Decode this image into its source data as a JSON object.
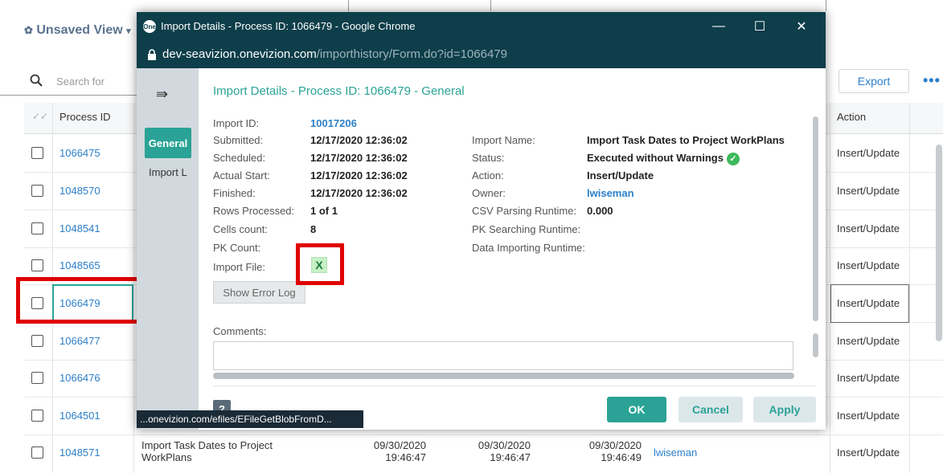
{
  "grid": {
    "view_title": "Unsaved View",
    "search_placeholder": "Search for",
    "export_label": "Export",
    "more_label": "•••",
    "col_process_id": "Process ID",
    "col_action": "Action",
    "rows": [
      {
        "pid": "1066475",
        "action": "Insert/Update"
      },
      {
        "pid": "1048570",
        "action": "Insert/Update"
      },
      {
        "pid": "1048541",
        "action": "Insert/Update"
      },
      {
        "pid": "1048565",
        "action": "Insert/Update"
      },
      {
        "pid": "1066479",
        "action": "Insert/Update"
      },
      {
        "pid": "1066477",
        "action": "Insert/Update"
      },
      {
        "pid": "1066476",
        "action": "Insert/Update"
      },
      {
        "pid": "1064501",
        "action": "Insert/Update"
      },
      {
        "pid": "1048571",
        "action": "Insert/Update",
        "name_line1": "Import Task Dates to Project",
        "name_line2": "WorkPlans",
        "date1": "09/30/2020",
        "time1": "19:46:47",
        "date2": "09/30/2020",
        "time2": "19:46:47",
        "date3": "09/30/2020",
        "time3": "19:46:49",
        "owner": "lwiseman"
      }
    ]
  },
  "window": {
    "title": "Import Details - Process ID: 1066479 - Google Chrome",
    "logo_text": "One",
    "url_host": "dev-seavizion.onevizion.com",
    "url_path": "/importhistory/Form.do?id=1066479",
    "min_glyph": "—",
    "max_glyph": "☐",
    "close_glyph": "✕",
    "status_url": "...onevizion.com/efiles/EFileGetBlobFromD..."
  },
  "sidebar": {
    "collapse_glyph": "⇛",
    "tab_general": "General",
    "tab_import": "Import L"
  },
  "details": {
    "heading": "Import Details - Process ID: 1066479 - General",
    "left": [
      {
        "label": "Import ID:",
        "value": "10017206",
        "link": true
      },
      {
        "label": "Submitted:",
        "value": "12/17/2020 12:36:02"
      },
      {
        "label": "Scheduled:",
        "value": "12/17/2020 12:36:02"
      },
      {
        "label": "Actual Start:",
        "value": "12/17/2020 12:36:02"
      },
      {
        "label": "Finished:",
        "value": "12/17/2020 12:36:02"
      },
      {
        "label": "Rows Processed:",
        "value": "1 of 1"
      },
      {
        "label": "Cells count:",
        "value": "8"
      },
      {
        "label": "PK Count:",
        "value": ""
      },
      {
        "label": "Import File:",
        "value": ""
      }
    ],
    "right": [
      {
        "label": "Import Name:",
        "value": "Import Task Dates to Project WorkPlans"
      },
      {
        "label": "Status:",
        "value": "Executed without Warnings"
      },
      {
        "label": "Action:",
        "value": "Insert/Update"
      },
      {
        "label": "Owner:",
        "value": "lwiseman",
        "link": true
      },
      {
        "label": "CSV Parsing Runtime:",
        "value": "0.000"
      },
      {
        "label": "PK Searching Runtime:",
        "value": ""
      },
      {
        "label": "Data Importing Runtime:",
        "value": ""
      }
    ],
    "file_icon_glyph": "X",
    "show_error_log": "Show Error Log",
    "comments_label": "Comments:"
  },
  "footer": {
    "help": "?",
    "ok": "OK",
    "cancel": "Cancel",
    "apply": "Apply"
  },
  "colors": {
    "accent": "#2aa396",
    "link": "#2b7fc9",
    "titlebar": "#0d3e4a",
    "highlight": "#e00000"
  }
}
